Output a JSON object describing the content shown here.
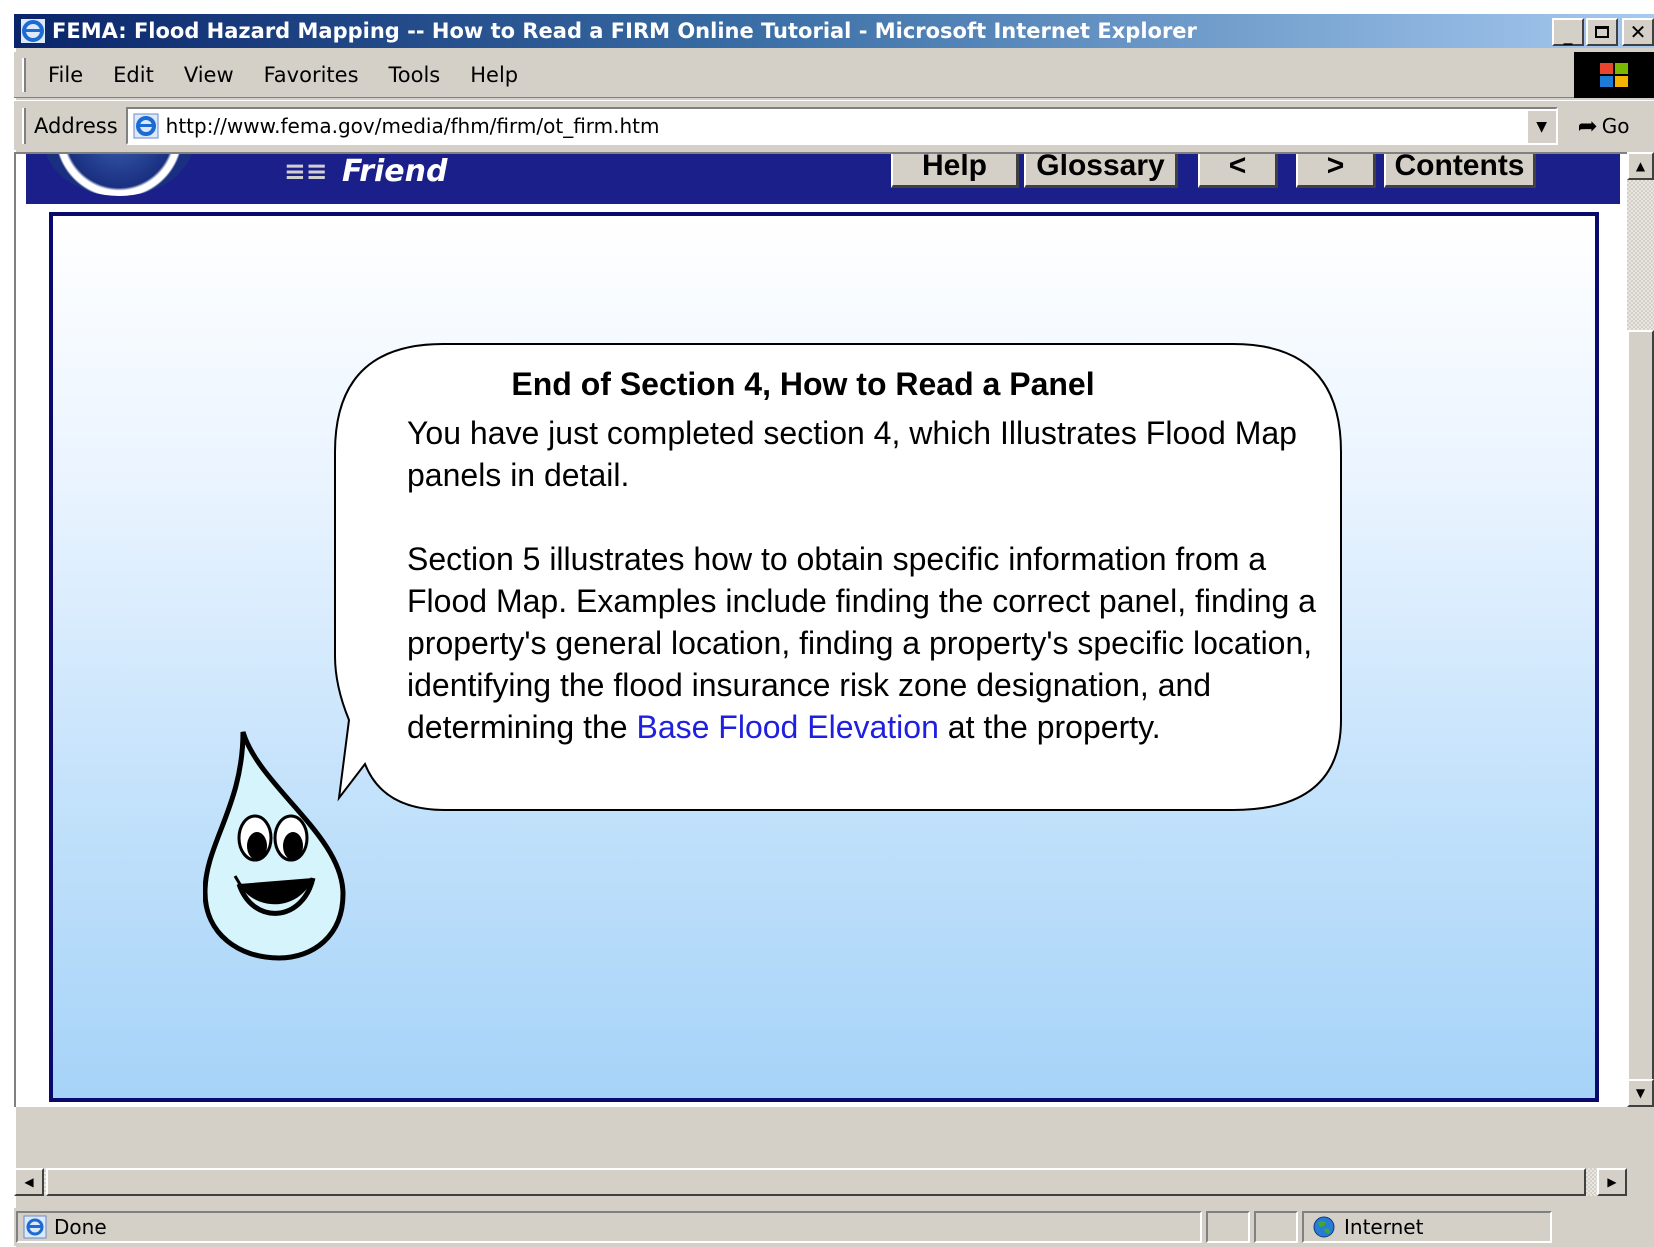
{
  "window": {
    "title": "FEMA: Flood Hazard Mapping -- How to Read a FIRM Online Tutorial - Microsoft Internet Explorer",
    "controls": [
      "_",
      "□",
      "×"
    ]
  },
  "menubar": {
    "items": [
      "File",
      "Edit",
      "View",
      "Favorites",
      "Tools",
      "Help"
    ]
  },
  "address": {
    "label": "Address",
    "url": "http://www.fema.gov/media/fhm/firm/ot_firm.htm",
    "go_label": "Go"
  },
  "site_nav": {
    "tell_friend": "Friend",
    "buttons": [
      "Help",
      "Glossary",
      "<",
      ">",
      "Contents"
    ]
  },
  "content": {
    "heading": "End of Section 4, How to Read a Panel",
    "paragraph1": "You have just completed section 4, which Illustrates Flood Map panels in detail.",
    "paragraph2_before": "Section 5 illustrates how to obtain specific information from a Flood Map. Examples include finding the correct panel, finding a property's general location, finding a property's specific location, identifying the flood insurance risk zone designation, and determining the ",
    "paragraph2_link": "Base Flood Elevation",
    "paragraph2_after": " at the property."
  },
  "statusbar": {
    "status": "Done",
    "zone": "Internet"
  },
  "colors": {
    "header_navy": "#1b1f8a",
    "link_blue": "#1f1fe0",
    "titlebar_start": "#0a246a",
    "stage_bottom": "#a6d3f8"
  }
}
